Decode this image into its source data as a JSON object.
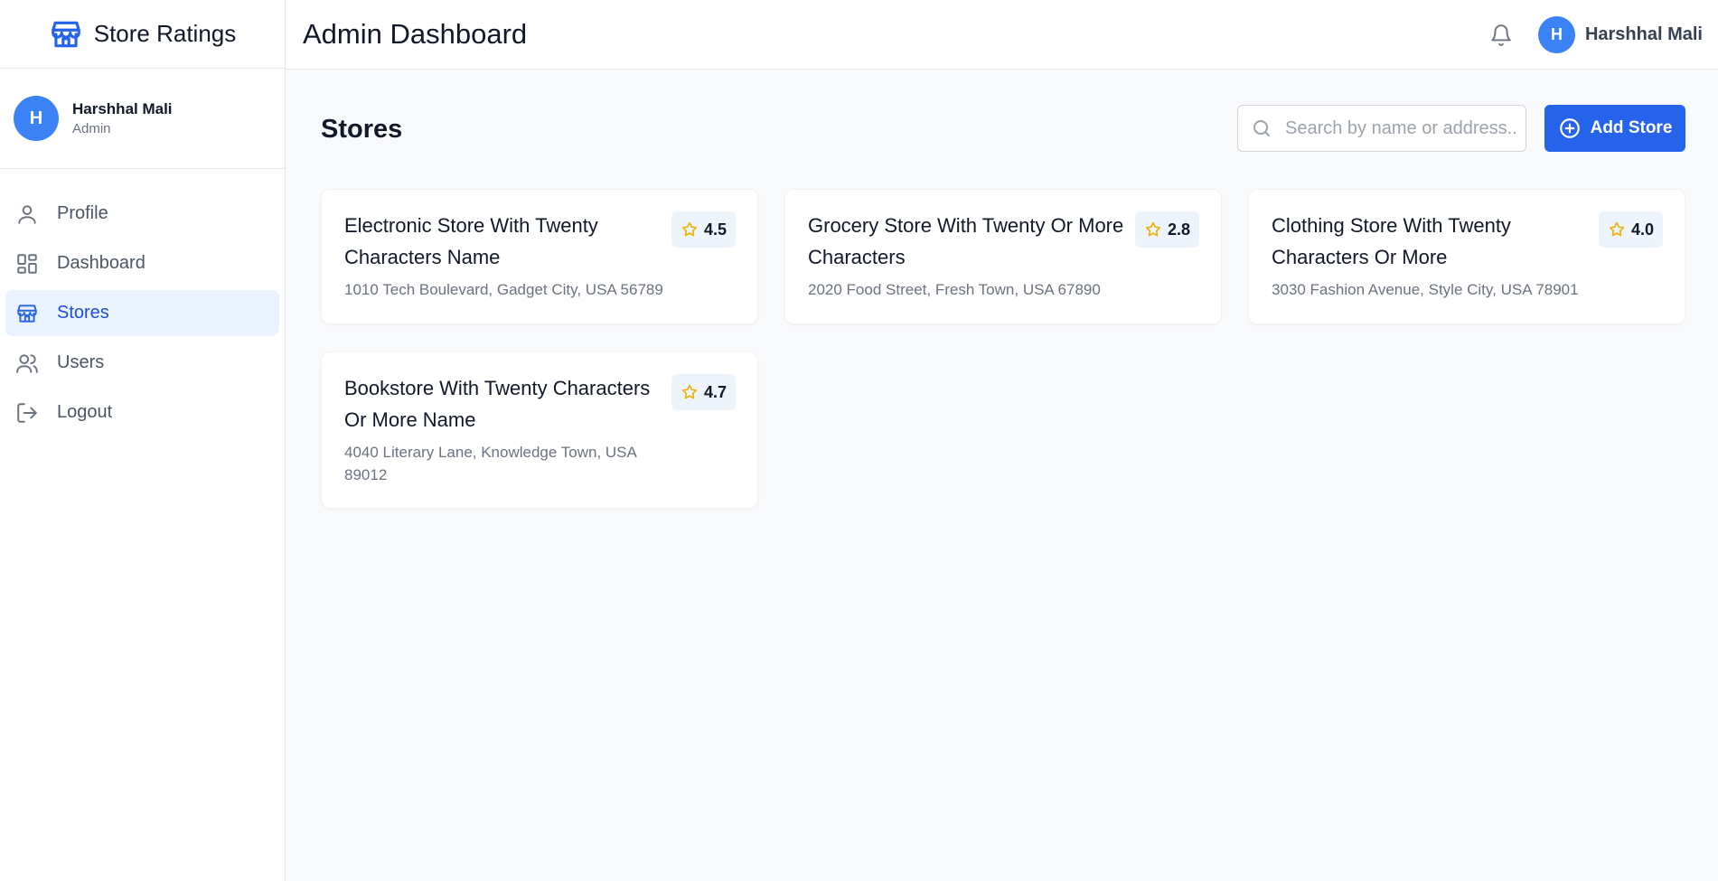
{
  "app": {
    "title": "Store Ratings"
  },
  "sidebar": {
    "user": {
      "initial": "H",
      "name": "Harshhal Mali",
      "role": "Admin"
    },
    "items": [
      {
        "label": "Profile",
        "icon": "user-icon",
        "active": false
      },
      {
        "label": "Dashboard",
        "icon": "dashboard-icon",
        "active": false
      },
      {
        "label": "Stores",
        "icon": "store-icon",
        "active": true
      },
      {
        "label": "Users",
        "icon": "users-icon",
        "active": false
      },
      {
        "label": "Logout",
        "icon": "logout-icon",
        "active": false
      }
    ]
  },
  "header": {
    "title": "Admin Dashboard",
    "user": {
      "initial": "H",
      "name": "Harshhal Mali"
    }
  },
  "main": {
    "title": "Stores",
    "search": {
      "placeholder": "Search by name or address..",
      "value": ""
    },
    "add_button": "Add Store",
    "stores": [
      {
        "name": "Electronic Store With Twenty Characters Name",
        "address": "1010 Tech Boulevard, Gadget City, USA 56789",
        "rating": "4.5"
      },
      {
        "name": "Grocery Store With Twenty Or More Characters",
        "address": "2020 Food Street, Fresh Town, USA 67890",
        "rating": "2.8"
      },
      {
        "name": "Clothing Store With Twenty Characters Or More",
        "address": "3030 Fashion Avenue, Style City, USA 78901",
        "rating": "4.0"
      },
      {
        "name": "Bookstore With Twenty Characters Or More Name",
        "address": "4040 Literary Lane, Knowledge Town, USA 89012",
        "rating": "4.7"
      }
    ]
  },
  "colors": {
    "accent": "#2563eb",
    "avatar": "#3b82f6",
    "active_nav_bg": "#eaf3fe",
    "star": "#eab308",
    "page_bg": "#f8f9fb"
  }
}
